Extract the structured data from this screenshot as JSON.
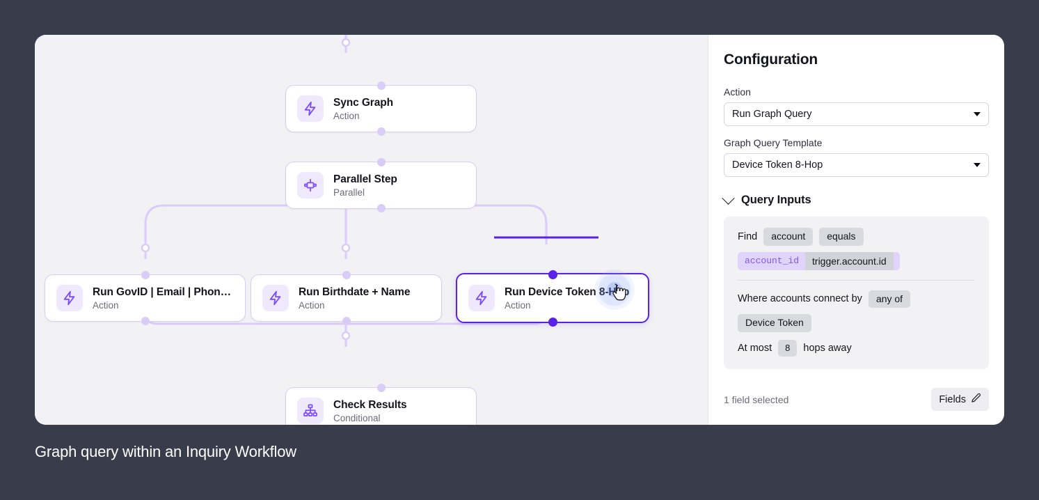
{
  "colors": {
    "background": "#393c4a",
    "canvas": "#f2f2f4",
    "panel": "#ffffff",
    "accent": "#5a21e8",
    "edge": "#d9cdf7",
    "icon_bg": "#efe9fd",
    "chip": "#d9d9e0",
    "var_chip": "#e0d4fb",
    "mono_text": "#8257e5"
  },
  "caption": "Graph query within an Inquiry Workflow",
  "workflow": {
    "nodes": [
      {
        "id": "sync-graph",
        "title": "Sync Graph",
        "subtitle": "Action",
        "icon": "zap-icon",
        "selected": false
      },
      {
        "id": "parallel-step",
        "title": "Parallel Step",
        "subtitle": "Parallel",
        "icon": "parallel-icon",
        "selected": false
      },
      {
        "id": "run-govid",
        "title": "Run GovID | Email | Phon…",
        "subtitle": "Action",
        "icon": "zap-icon",
        "selected": false
      },
      {
        "id": "run-birthdate",
        "title": "Run Birthdate + Name",
        "subtitle": "Action",
        "icon": "zap-icon",
        "selected": false
      },
      {
        "id": "run-device-token",
        "title": "Run Device Token 8-Hop",
        "subtitle": "Action",
        "icon": "zap-icon",
        "selected": true
      },
      {
        "id": "check-results",
        "title": "Check Results",
        "subtitle": "Conditional",
        "icon": "hierarchy-icon",
        "selected": false
      }
    ]
  },
  "panel": {
    "title": "Configuration",
    "action": {
      "label": "Action",
      "value": "Run Graph Query"
    },
    "template": {
      "label": "Graph Query Template",
      "value": "Device Token 8-Hop"
    },
    "query_inputs": {
      "section_title": "Query Inputs",
      "find_label": "Find",
      "find_entity": "account",
      "find_operator": "equals",
      "var_key": "account_id",
      "var_value": "trigger.account.id",
      "connect_label": "Where accounts connect by",
      "connect_operator": "any of",
      "connect_value": "Device Token",
      "hops_prefix": "At most",
      "hops_count": "8",
      "hops_suffix": "hops away"
    },
    "footer": {
      "note": "1 field selected",
      "fields_button": "Fields"
    }
  }
}
